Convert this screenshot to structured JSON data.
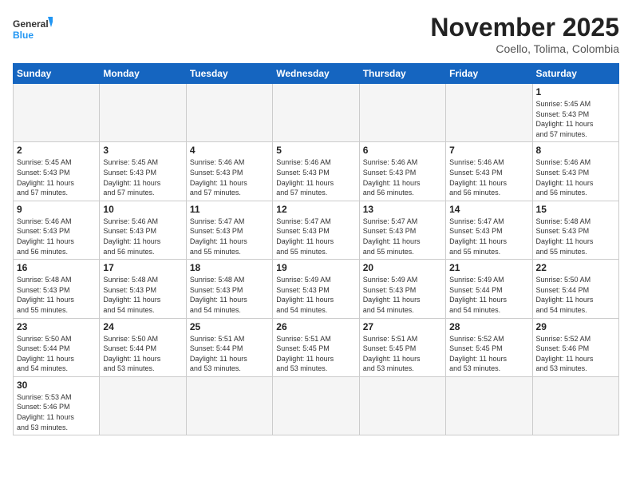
{
  "logo": {
    "text_general": "General",
    "text_blue": "Blue"
  },
  "header": {
    "month": "November 2025",
    "location": "Coello, Tolima, Colombia"
  },
  "weekdays": [
    "Sunday",
    "Monday",
    "Tuesday",
    "Wednesday",
    "Thursday",
    "Friday",
    "Saturday"
  ],
  "weeks": [
    [
      {
        "day": "",
        "info": ""
      },
      {
        "day": "",
        "info": ""
      },
      {
        "day": "",
        "info": ""
      },
      {
        "day": "",
        "info": ""
      },
      {
        "day": "",
        "info": ""
      },
      {
        "day": "",
        "info": ""
      },
      {
        "day": "1",
        "info": "Sunrise: 5:45 AM\nSunset: 5:43 PM\nDaylight: 11 hours\nand 57 minutes."
      }
    ],
    [
      {
        "day": "2",
        "info": "Sunrise: 5:45 AM\nSunset: 5:43 PM\nDaylight: 11 hours\nand 57 minutes."
      },
      {
        "day": "3",
        "info": "Sunrise: 5:45 AM\nSunset: 5:43 PM\nDaylight: 11 hours\nand 57 minutes."
      },
      {
        "day": "4",
        "info": "Sunrise: 5:46 AM\nSunset: 5:43 PM\nDaylight: 11 hours\nand 57 minutes."
      },
      {
        "day": "5",
        "info": "Sunrise: 5:46 AM\nSunset: 5:43 PM\nDaylight: 11 hours\nand 57 minutes."
      },
      {
        "day": "6",
        "info": "Sunrise: 5:46 AM\nSunset: 5:43 PM\nDaylight: 11 hours\nand 56 minutes."
      },
      {
        "day": "7",
        "info": "Sunrise: 5:46 AM\nSunset: 5:43 PM\nDaylight: 11 hours\nand 56 minutes."
      },
      {
        "day": "8",
        "info": "Sunrise: 5:46 AM\nSunset: 5:43 PM\nDaylight: 11 hours\nand 56 minutes."
      }
    ],
    [
      {
        "day": "9",
        "info": "Sunrise: 5:46 AM\nSunset: 5:43 PM\nDaylight: 11 hours\nand 56 minutes."
      },
      {
        "day": "10",
        "info": "Sunrise: 5:46 AM\nSunset: 5:43 PM\nDaylight: 11 hours\nand 56 minutes."
      },
      {
        "day": "11",
        "info": "Sunrise: 5:47 AM\nSunset: 5:43 PM\nDaylight: 11 hours\nand 55 minutes."
      },
      {
        "day": "12",
        "info": "Sunrise: 5:47 AM\nSunset: 5:43 PM\nDaylight: 11 hours\nand 55 minutes."
      },
      {
        "day": "13",
        "info": "Sunrise: 5:47 AM\nSunset: 5:43 PM\nDaylight: 11 hours\nand 55 minutes."
      },
      {
        "day": "14",
        "info": "Sunrise: 5:47 AM\nSunset: 5:43 PM\nDaylight: 11 hours\nand 55 minutes."
      },
      {
        "day": "15",
        "info": "Sunrise: 5:48 AM\nSunset: 5:43 PM\nDaylight: 11 hours\nand 55 minutes."
      }
    ],
    [
      {
        "day": "16",
        "info": "Sunrise: 5:48 AM\nSunset: 5:43 PM\nDaylight: 11 hours\nand 55 minutes."
      },
      {
        "day": "17",
        "info": "Sunrise: 5:48 AM\nSunset: 5:43 PM\nDaylight: 11 hours\nand 54 minutes."
      },
      {
        "day": "18",
        "info": "Sunrise: 5:48 AM\nSunset: 5:43 PM\nDaylight: 11 hours\nand 54 minutes."
      },
      {
        "day": "19",
        "info": "Sunrise: 5:49 AM\nSunset: 5:43 PM\nDaylight: 11 hours\nand 54 minutes."
      },
      {
        "day": "20",
        "info": "Sunrise: 5:49 AM\nSunset: 5:43 PM\nDaylight: 11 hours\nand 54 minutes."
      },
      {
        "day": "21",
        "info": "Sunrise: 5:49 AM\nSunset: 5:44 PM\nDaylight: 11 hours\nand 54 minutes."
      },
      {
        "day": "22",
        "info": "Sunrise: 5:50 AM\nSunset: 5:44 PM\nDaylight: 11 hours\nand 54 minutes."
      }
    ],
    [
      {
        "day": "23",
        "info": "Sunrise: 5:50 AM\nSunset: 5:44 PM\nDaylight: 11 hours\nand 54 minutes."
      },
      {
        "day": "24",
        "info": "Sunrise: 5:50 AM\nSunset: 5:44 PM\nDaylight: 11 hours\nand 53 minutes."
      },
      {
        "day": "25",
        "info": "Sunrise: 5:51 AM\nSunset: 5:44 PM\nDaylight: 11 hours\nand 53 minutes."
      },
      {
        "day": "26",
        "info": "Sunrise: 5:51 AM\nSunset: 5:45 PM\nDaylight: 11 hours\nand 53 minutes."
      },
      {
        "day": "27",
        "info": "Sunrise: 5:51 AM\nSunset: 5:45 PM\nDaylight: 11 hours\nand 53 minutes."
      },
      {
        "day": "28",
        "info": "Sunrise: 5:52 AM\nSunset: 5:45 PM\nDaylight: 11 hours\nand 53 minutes."
      },
      {
        "day": "29",
        "info": "Sunrise: 5:52 AM\nSunset: 5:46 PM\nDaylight: 11 hours\nand 53 minutes."
      }
    ],
    [
      {
        "day": "30",
        "info": "Sunrise: 5:53 AM\nSunset: 5:46 PM\nDaylight: 11 hours\nand 53 minutes."
      },
      {
        "day": "",
        "info": ""
      },
      {
        "day": "",
        "info": ""
      },
      {
        "day": "",
        "info": ""
      },
      {
        "day": "",
        "info": ""
      },
      {
        "day": "",
        "info": ""
      },
      {
        "day": "",
        "info": ""
      }
    ]
  ]
}
